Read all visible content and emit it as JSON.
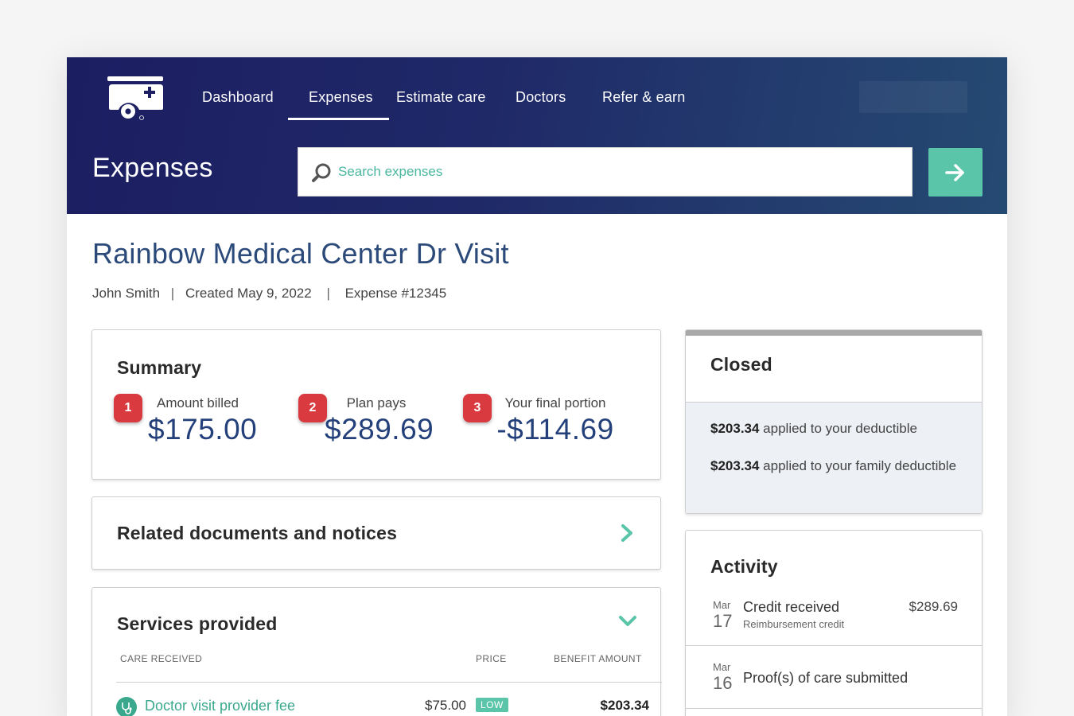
{
  "nav": {
    "items": [
      {
        "label": "Dashboard"
      },
      {
        "label": "Expenses"
      },
      {
        "label": "Estimate care"
      },
      {
        "label": "Doctors"
      },
      {
        "label": "Refer & earn"
      }
    ],
    "active": "Expenses"
  },
  "header": {
    "page_title": "Expenses",
    "search_placeholder": "Search expenses",
    "go_icon": "arrow-right-icon"
  },
  "expense": {
    "title": "Rainbow Medical Center Dr Visit",
    "patient": "John Smith",
    "created": "Created May 9, 2022",
    "number": "Expense #12345",
    "separator": "|"
  },
  "summary": {
    "title": "Summary",
    "stats": [
      {
        "marker": "1",
        "label": "Amount billed",
        "value": "$175.00"
      },
      {
        "marker": "2",
        "label": "Plan pays",
        "value": "$289.69"
      },
      {
        "marker": "3",
        "label": "Your final portion",
        "value": "-$114.69"
      }
    ]
  },
  "related": {
    "title": "Related documents and notices"
  },
  "services": {
    "title": "Services provided",
    "columns": [
      "CARE RECEIVED",
      "PRICE",
      "BENEFIT AMOUNT"
    ],
    "rows": [
      {
        "name": "Doctor visit provider fee",
        "price": "$75.00",
        "badge": "LOW",
        "benefit": "$203.34",
        "icon": "stethoscope-icon"
      }
    ]
  },
  "status": {
    "title": "Closed",
    "deductibles": [
      {
        "amount": "$203.34",
        "text": " applied to your deductible"
      },
      {
        "amount": "$203.34",
        "text": " applied to your family deductible"
      }
    ]
  },
  "activity": {
    "title": "Activity",
    "items": [
      {
        "month": "Mar",
        "day": "17",
        "title": "Credit received",
        "subtitle": "Reimbursement credit",
        "amount": "$289.69"
      },
      {
        "month": "Mar",
        "day": "16",
        "title": "Proof(s) of care submitted",
        "subtitle": "",
        "amount": ""
      }
    ]
  },
  "colors": {
    "header_navy": "#1c1e62",
    "accent_teal": "#5ac5a8",
    "title_blue": "#2b4a7a",
    "marker_red": "#d83a3f",
    "status_gray": "#a9a9a9"
  }
}
